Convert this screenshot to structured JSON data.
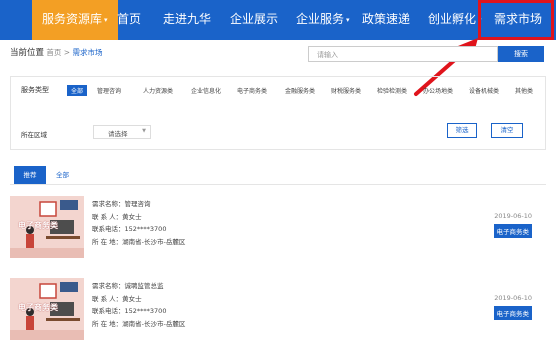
{
  "nav": {
    "items": [
      {
        "label": "服务资源库",
        "dropdown": true,
        "active": true
      },
      {
        "label": "首页",
        "dropdown": false
      },
      {
        "label": "走进九华",
        "dropdown": false
      },
      {
        "label": "企业展示",
        "dropdown": false
      },
      {
        "label": "企业服务",
        "dropdown": true
      },
      {
        "label": "政策速递",
        "dropdown": false
      },
      {
        "label": "创业孵化",
        "dropdown": true
      },
      {
        "label": "需求市场",
        "dropdown": false
      }
    ],
    "caret": "▾"
  },
  "breadcrumb": {
    "label": "当前位置",
    "home": "首页",
    "sep": ">",
    "current": "需求市场"
  },
  "search": {
    "placeholder": "请输入",
    "button": "搜索"
  },
  "filters": {
    "service_type_label": "服务类型",
    "service_types": [
      "全部",
      "管理咨询",
      "人力资源类",
      "企业信息化",
      "电子商务类",
      "金融服务类",
      "财税服务类",
      "检验检测类",
      "办公场地类",
      "设备机械类",
      "其他类"
    ],
    "region_label": "所在区域",
    "region_select": "请选择",
    "filter_button": "筛选",
    "clear_button": "清空"
  },
  "tabs": [
    "推荐",
    "全部"
  ],
  "listings": [
    {
      "thumb_label": "电子商务类",
      "name": "需求名称：管理咨询",
      "contact": "联 系 人：黄女士",
      "phone": "联系电话：152****3700",
      "location": "所 在 地：湖南省-长沙市-岳麓区",
      "date": "2019-06-10",
      "category": "电子商务类"
    },
    {
      "thumb_label": "电子商务类",
      "name": "需求名称：诚聘监管总监",
      "contact": "联 系 人：黄女士",
      "phone": "联系电话：152****3700",
      "location": "所 在 地：湖南省-长沙市-岳麓区",
      "date": "2019-06-10",
      "category": "电子商务类"
    }
  ],
  "colors": {
    "nav_bg": "#1a63c9",
    "nav_active": "#f39f24",
    "highlight": "#e0141c"
  }
}
